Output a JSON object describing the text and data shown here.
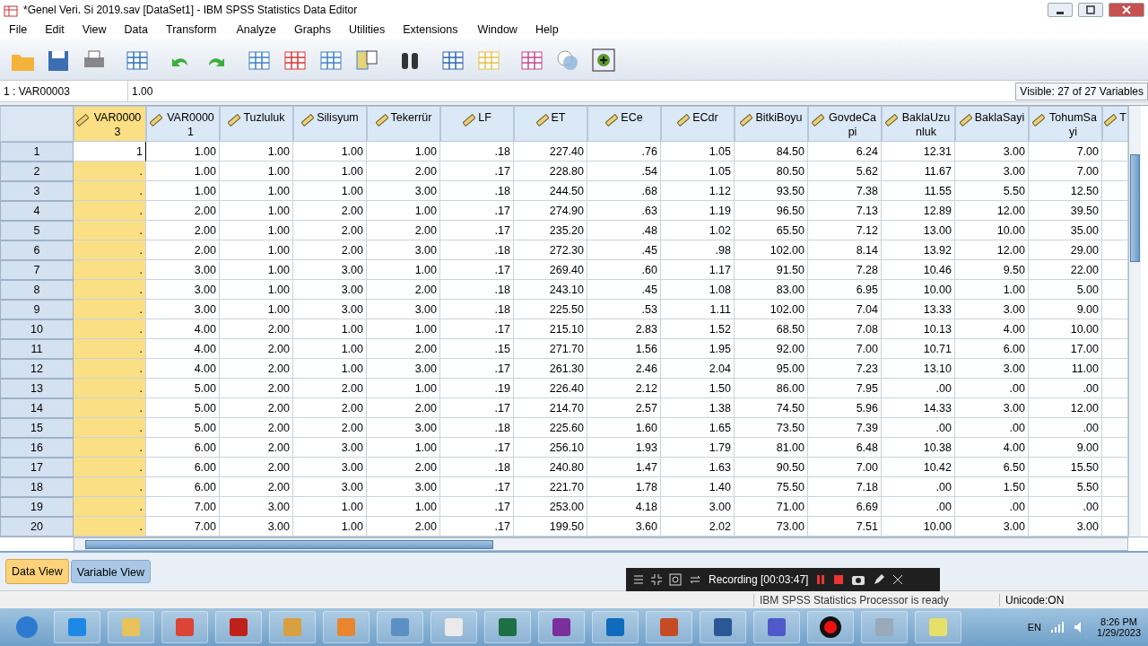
{
  "window": {
    "title": "*Genel Veri. Si 2019.sav [DataSet1] - IBM SPSS Statistics Data Editor"
  },
  "menu": [
    "File",
    "Edit",
    "View",
    "Data",
    "Transform",
    "Analyze",
    "Graphs",
    "Utilities",
    "Extensions",
    "Window",
    "Help"
  ],
  "cell_editor": {
    "cell": "1 : VAR00003",
    "value": "1.00",
    "visible": "Visible: 27 of 27 Variables"
  },
  "table": {
    "columns": [
      {
        "name": "VAR00003",
        "selected": true
      },
      {
        "name": "VAR00001",
        "selected": false
      },
      {
        "name": "Tuzluluk",
        "selected": false
      },
      {
        "name": "Silisyum",
        "selected": false
      },
      {
        "name": "Tekerrür",
        "selected": false
      },
      {
        "name": "LF",
        "selected": false
      },
      {
        "name": "ET",
        "selected": false
      },
      {
        "name": "ECe",
        "selected": false
      },
      {
        "name": "ECdr",
        "selected": false
      },
      {
        "name": "BitkiBoyu",
        "selected": false
      },
      {
        "name": "GovdeCapi",
        "selected": false
      },
      {
        "name": "BaklaUzunluk",
        "selected": false
      },
      {
        "name": "BaklaSayi",
        "selected": false
      },
      {
        "name": "TohumSayi",
        "selected": false
      },
      {
        "name": "T",
        "selected": false
      }
    ],
    "rows": [
      {
        "label": "1",
        "editing": true,
        "cells": [
          "1",
          "1.00",
          "1.00",
          "1.00",
          "1.00",
          ".18",
          "227.40",
          ".76",
          "1.05",
          "84.50",
          "6.24",
          "12.31",
          "3.00",
          "7.00"
        ]
      },
      {
        "label": "2",
        "editing": false,
        "cells": [
          ".",
          "1.00",
          "1.00",
          "1.00",
          "2.00",
          ".17",
          "228.80",
          ".54",
          "1.05",
          "80.50",
          "5.62",
          "11.67",
          "3.00",
          "7.00"
        ]
      },
      {
        "label": "3",
        "editing": false,
        "cells": [
          ".",
          "1.00",
          "1.00",
          "1.00",
          "3.00",
          ".18",
          "244.50",
          ".68",
          "1.12",
          "93.50",
          "7.38",
          "11.55",
          "5.50",
          "12.50"
        ]
      },
      {
        "label": "4",
        "editing": false,
        "cells": [
          ".",
          "2.00",
          "1.00",
          "2.00",
          "1.00",
          ".17",
          "274.90",
          ".63",
          "1.19",
          "96.50",
          "7.13",
          "12.89",
          "12.00",
          "39.50"
        ]
      },
      {
        "label": "5",
        "editing": false,
        "cells": [
          ".",
          "2.00",
          "1.00",
          "2.00",
          "2.00",
          ".17",
          "235.20",
          ".48",
          "1.02",
          "65.50",
          "7.12",
          "13.00",
          "10.00",
          "35.00"
        ]
      },
      {
        "label": "6",
        "editing": false,
        "cells": [
          ".",
          "2.00",
          "1.00",
          "2.00",
          "3.00",
          ".18",
          "272.30",
          ".45",
          ".98",
          "102.00",
          "8.14",
          "13.92",
          "12.00",
          "29.00"
        ]
      },
      {
        "label": "7",
        "editing": false,
        "cells": [
          ".",
          "3.00",
          "1.00",
          "3.00",
          "1.00",
          ".17",
          "269.40",
          ".60",
          "1.17",
          "91.50",
          "7.28",
          "10.46",
          "9.50",
          "22.00"
        ]
      },
      {
        "label": "8",
        "editing": false,
        "cells": [
          ".",
          "3.00",
          "1.00",
          "3.00",
          "2.00",
          ".18",
          "243.10",
          ".45",
          "1.08",
          "83.00",
          "6.95",
          "10.00",
          "1.00",
          "5.00"
        ]
      },
      {
        "label": "9",
        "editing": false,
        "cells": [
          ".",
          "3.00",
          "1.00",
          "3.00",
          "3.00",
          ".18",
          "225.50",
          ".53",
          "1.11",
          "102.00",
          "7.04",
          "13.33",
          "3.00",
          "9.00"
        ]
      },
      {
        "label": "10",
        "editing": false,
        "cells": [
          ".",
          "4.00",
          "2.00",
          "1.00",
          "1.00",
          ".17",
          "215.10",
          "2.83",
          "1.52",
          "68.50",
          "7.08",
          "10.13",
          "4.00",
          "10.00"
        ]
      },
      {
        "label": "11",
        "editing": false,
        "cells": [
          ".",
          "4.00",
          "2.00",
          "1.00",
          "2.00",
          ".15",
          "271.70",
          "1.56",
          "1.95",
          "92.00",
          "7.00",
          "10.71",
          "6.00",
          "17.00"
        ]
      },
      {
        "label": "12",
        "editing": false,
        "cells": [
          ".",
          "4.00",
          "2.00",
          "1.00",
          "3.00",
          ".17",
          "261.30",
          "2.46",
          "2.04",
          "95.00",
          "7.23",
          "13.10",
          "3.00",
          "11.00"
        ]
      },
      {
        "label": "13",
        "editing": false,
        "cells": [
          ".",
          "5.00",
          "2.00",
          "2.00",
          "1.00",
          ".19",
          "226.40",
          "2.12",
          "1.50",
          "86.00",
          "7.95",
          ".00",
          ".00",
          ".00"
        ]
      },
      {
        "label": "14",
        "editing": false,
        "cells": [
          ".",
          "5.00",
          "2.00",
          "2.00",
          "2.00",
          ".17",
          "214.70",
          "2.57",
          "1.38",
          "74.50",
          "5.96",
          "14.33",
          "3.00",
          "12.00"
        ]
      },
      {
        "label": "15",
        "editing": false,
        "cells": [
          ".",
          "5.00",
          "2.00",
          "2.00",
          "3.00",
          ".18",
          "225.60",
          "1.60",
          "1.65",
          "73.50",
          "7.39",
          ".00",
          ".00",
          ".00"
        ]
      },
      {
        "label": "16",
        "editing": false,
        "cells": [
          ".",
          "6.00",
          "2.00",
          "3.00",
          "1.00",
          ".17",
          "256.10",
          "1.93",
          "1.79",
          "81.00",
          "6.48",
          "10.38",
          "4.00",
          "9.00"
        ]
      },
      {
        "label": "17",
        "editing": false,
        "cells": [
          ".",
          "6.00",
          "2.00",
          "3.00",
          "2.00",
          ".18",
          "240.80",
          "1.47",
          "1.63",
          "90.50",
          "7.00",
          "10.42",
          "6.50",
          "15.50"
        ]
      },
      {
        "label": "18",
        "editing": false,
        "cells": [
          ".",
          "6.00",
          "2.00",
          "3.00",
          "3.00",
          ".17",
          "221.70",
          "1.78",
          "1.40",
          "75.50",
          "7.18",
          ".00",
          "1.50",
          "5.50"
        ]
      },
      {
        "label": "19",
        "editing": false,
        "cells": [
          ".",
          "7.00",
          "3.00",
          "1.00",
          "1.00",
          ".17",
          "253.00",
          "4.18",
          "3.00",
          "71.00",
          "6.69",
          ".00",
          ".00",
          ".00"
        ]
      },
      {
        "label": "20",
        "editing": false,
        "cells": [
          ".",
          "7.00",
          "3.00",
          "1.00",
          "2.00",
          ".17",
          "199.50",
          "3.60",
          "2.02",
          "73.00",
          "7.51",
          "10.00",
          "3.00",
          "3.00"
        ]
      }
    ]
  },
  "view_tabs": [
    {
      "label": "Data View",
      "selected": true
    },
    {
      "label": "Variable View",
      "selected": false
    }
  ],
  "recording_bar": {
    "status": "Recording [00:03:47]"
  },
  "status_bar": {
    "message": "IBM SPSS Statistics Processor is ready",
    "encoding": "Unicode:ON"
  },
  "taskbar": {
    "language": "EN",
    "time": "8:26 PM",
    "date": "1/29/2023"
  }
}
